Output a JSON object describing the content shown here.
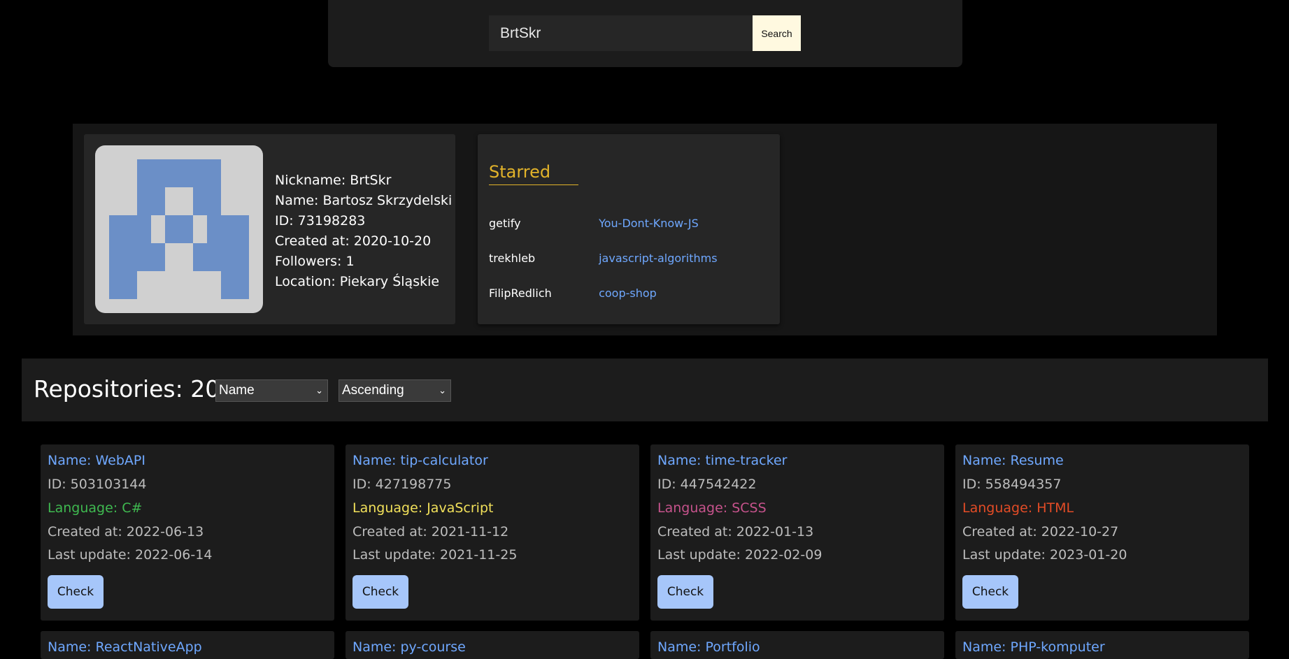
{
  "search": {
    "value": "BrtSkr",
    "button_label": "Search"
  },
  "user": {
    "nickname": "Nickname: BrtSkr",
    "name": "Name: Bartosz Skrzydelski",
    "id": "ID: 73198283",
    "created": "Created at: 2020-10-20",
    "followers": "Followers: 1",
    "location": "Location: Piekary Śląskie",
    "avatar_color": "#6b8fc7"
  },
  "starred": {
    "title": "Starred",
    "items": [
      {
        "owner": "getify",
        "repo": "You-Dont-Know-JS"
      },
      {
        "owner": "trekhleb",
        "repo": "javascript-algorithms"
      },
      {
        "owner": "FilipRedlich",
        "repo": "coop-shop"
      }
    ]
  },
  "repositories": {
    "title": "Repositories: 20",
    "sort_field": "Name",
    "sort_order": "Ascending",
    "check_label": "Check",
    "cards": [
      {
        "name": "Name: WebAPI",
        "id": "ID: 503103144",
        "language": "Language: C#",
        "lang_color": "#3fb950",
        "created": "Created at: 2022-06-13",
        "updated": "Last update: 2022-06-14"
      },
      {
        "name": "Name: tip-calculator",
        "id": "ID: 427198775",
        "language": "Language: JavaScript",
        "lang_color": "#f1e05a",
        "created": "Created at: 2021-11-12",
        "updated": "Last update: 2021-11-25"
      },
      {
        "name": "Name: time-tracker",
        "id": "ID: 447542422",
        "language": "Language: SCSS",
        "lang_color": "#c6538c",
        "created": "Created at: 2022-01-13",
        "updated": "Last update: 2022-02-09"
      },
      {
        "name": "Name: Resume",
        "id": "ID: 558494357",
        "language": "Language: HTML",
        "lang_color": "#e34c26",
        "created": "Created at: 2022-10-27",
        "updated": "Last update: 2023-01-20"
      }
    ],
    "next_row_names": [
      "Name: ReactNativeApp",
      "Name: py-course",
      "Name: Portfolio",
      "Name: PHP-komputer"
    ]
  }
}
